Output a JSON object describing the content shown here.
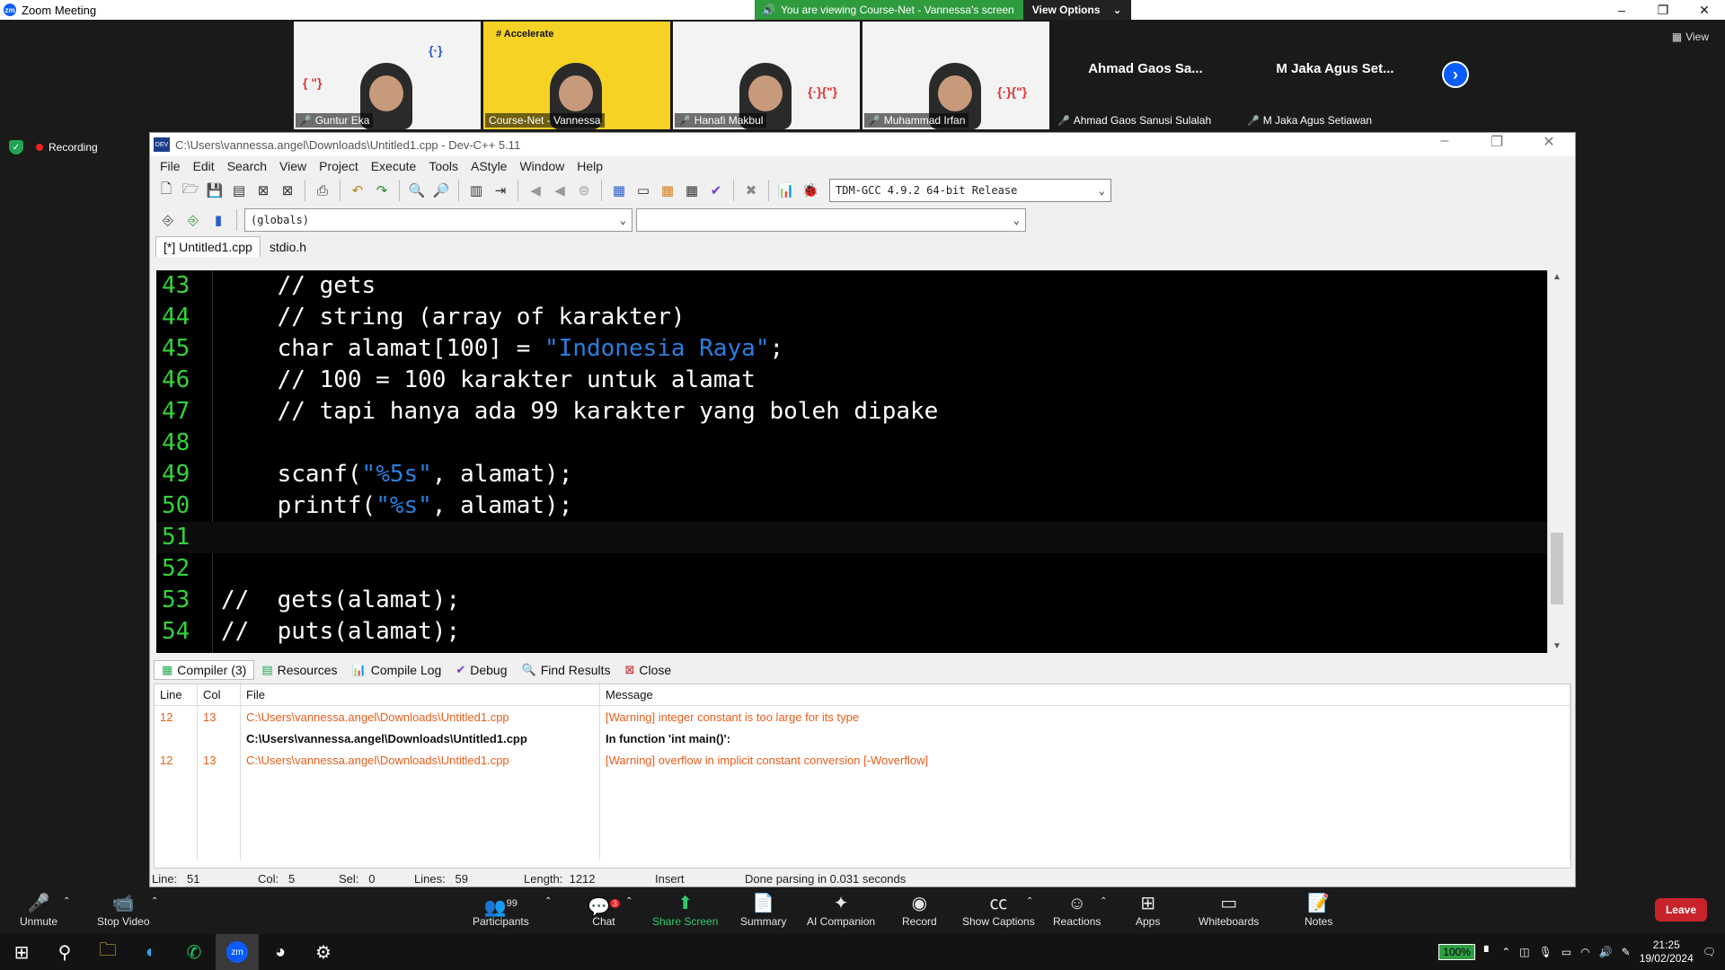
{
  "zoom": {
    "window_title": "Zoom Meeting",
    "share_banner": "You are viewing Course-Net - Vannessa's screen",
    "view_options": "View Options",
    "view_label": "View",
    "recording": "Recording",
    "participants_tiles": [
      {
        "name": "Guntur Eka"
      },
      {
        "name": "Course-Net - Vannessa"
      },
      {
        "name": "Hanafi Makbul"
      },
      {
        "name": "Muhammad Irfan"
      }
    ],
    "name_tiles": [
      {
        "big": "Ahmad Gaos Sa...",
        "name": "Ahmad Gaos Sanusi Sulalah"
      },
      {
        "big": "M Jaka Agus Set...",
        "name": "M Jaka Agus Setiawan"
      }
    ],
    "toolbar": {
      "unmute": "Unmute",
      "stop_video": "Stop Video",
      "participants": "Participants",
      "participants_count": "99",
      "chat": "Chat",
      "chat_badge": "3",
      "share": "Share Screen",
      "summary": "Summary",
      "ai": "AI Companion",
      "record": "Record",
      "captions": "Show Captions",
      "reactions": "Reactions",
      "apps": "Apps",
      "whiteboards": "Whiteboards",
      "notes": "Notes",
      "leave": "Leave"
    }
  },
  "devcpp": {
    "title": "C:\\Users\\vannessa.angel\\Downloads\\Untitled1.cpp - Dev-C++ 5.11",
    "menu": [
      "File",
      "Edit",
      "Search",
      "View",
      "Project",
      "Execute",
      "Tools",
      "AStyle",
      "Window",
      "Help"
    ],
    "compiler": "TDM-GCC 4.9.2 64-bit Release",
    "scope_combo": "(globals)",
    "tabs": [
      "[*] Untitled1.cpp",
      "stdio.h"
    ],
    "bottom_tabs": [
      "Compiler (3)",
      "Resources",
      "Compile Log",
      "Debug",
      "Find Results",
      "Close"
    ],
    "msg_headers": {
      "line": "Line",
      "col": "Col",
      "file": "File",
      "message": "Message"
    },
    "messages": [
      {
        "line": "12",
        "col": "13",
        "file": "C:\\Users\\vannessa.angel\\Downloads\\Untitled1.cpp",
        "message": "[Warning] integer constant is too large for its type"
      },
      {
        "line": "",
        "col": "",
        "file": "C:\\Users\\vannessa.angel\\Downloads\\Untitled1.cpp",
        "message": "In function 'int main()':"
      },
      {
        "line": "12",
        "col": "13",
        "file": "C:\\Users\\vannessa.angel\\Downloads\\Untitled1.cpp",
        "message": "[Warning] overflow in implicit constant conversion [-Woverflow]"
      }
    ],
    "status": {
      "line": "Line:   51",
      "col": "Col:   5",
      "sel": "Sel:   0",
      "lines": "Lines:   59",
      "length": "Length:  1212",
      "mode": "Insert",
      "parse": "Done parsing in 0.031 seconds"
    }
  },
  "taskbar": {
    "battery": "100%",
    "time": "21:25",
    "date": "19/02/2024"
  }
}
